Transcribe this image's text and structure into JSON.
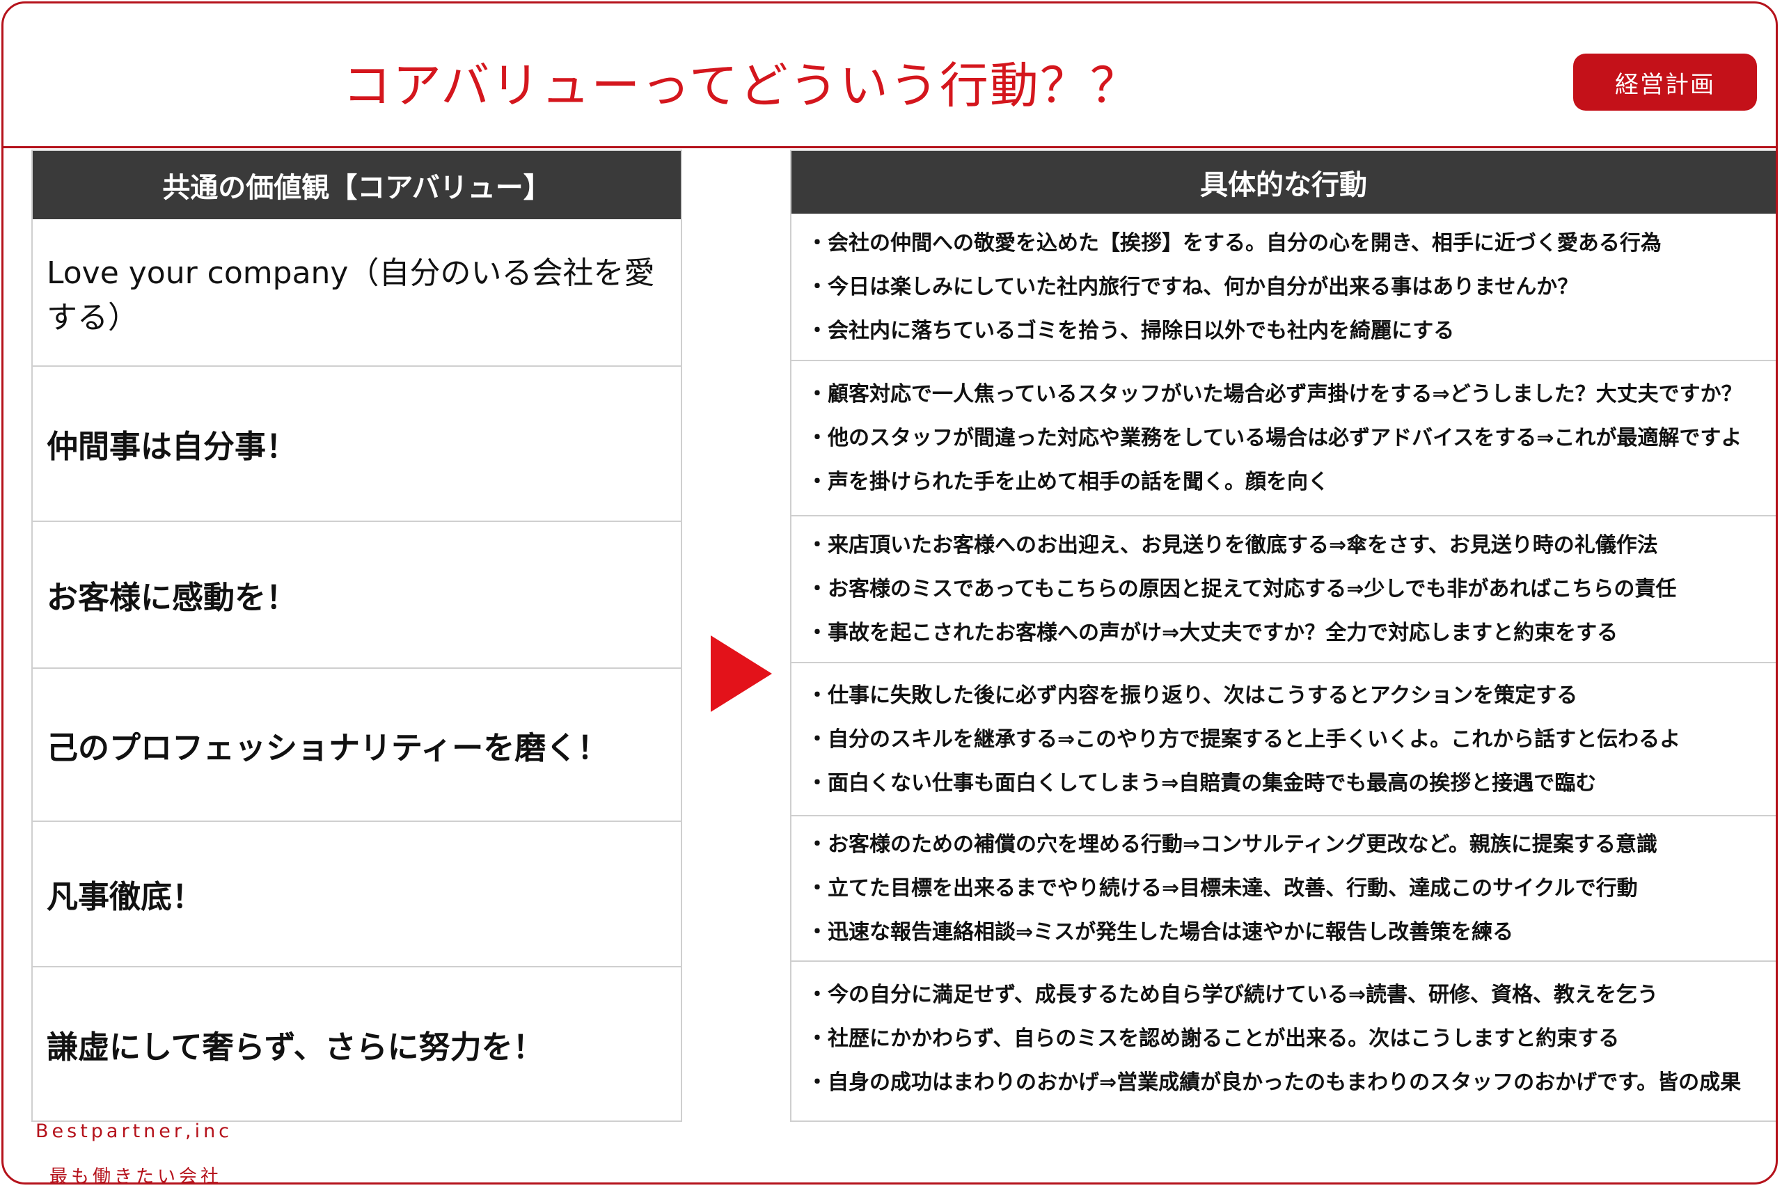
{
  "header": {
    "title": "コアバリューってどういう行動？？",
    "badge": "経営計画"
  },
  "left": {
    "heading": "共通の価値観【コアバリュー】",
    "values": [
      "Love your company（自分のいる会社を愛する）",
      "仲間事は自分事！",
      "お客様に感動を！",
      "己のプロフェッショナリティーを磨く！",
      "凡事徹底！",
      "謙虚にして奢らず、さらに努力を！"
    ]
  },
  "right": {
    "heading": "具体的な行動",
    "groups": [
      [
        "・会社の仲間への敬愛を込めた【挨拶】をする。自分の心を開き、相手に近づく愛ある行為",
        "・今日は楽しみにしていた社内旅行ですね、何か自分が出来る事はありませんか？",
        "・会社内に落ちているゴミを拾う、掃除日以外でも社内を綺麗にする"
      ],
      [
        "・顧客対応で一人焦っているスタッフがいた場合必ず声掛けをする⇒どうしました？大丈夫ですか？",
        "・他のスタッフが間違った対応や業務をしている場合は必ずアドバイスをする⇒これが最適解ですよ",
        "・声を掛けられた手を止めて相手の話を聞く。顔を向く"
      ],
      [
        "・来店頂いたお客様へのお出迎え、お見送りを徹底する⇒傘をさす、お見送り時の礼儀作法",
        "・お客様のミスであってもこちらの原因と捉えて対応する⇒少しでも非があればこちらの責任",
        "・事故を起こされたお客様への声がけ⇒大丈夫ですか？全力で対応しますと約束をする"
      ],
      [
        "・仕事に失敗した後に必ず内容を振り返り、次はこうするとアクションを策定する",
        "・自分のスキルを継承する⇒このやり方で提案すると上手くいくよ。これから話すと伝わるよ",
        "・面白くない仕事も面白くしてしまう⇒自賠責の集金時でも最高の挨拶と接遇で臨む"
      ],
      [
        "・お客様のための補償の穴を埋める行動⇒コンサルティング更改など。親族に提案する意識",
        "・立てた目標を出来るまでやり続ける⇒目標未達、改善、行動、達成このサイクルで行動",
        "・迅速な報告連絡相談⇒ミスが発生した場合は速やかに報告し改善策を練る"
      ],
      [
        "・今の自分に満足せず、成長するため自ら学び続けている⇒読書、研修、資格、教えを乞う",
        "・社歴にかかわらず、自らのミスを認め謝ることが出来る。次はこうしますと約束する",
        "・自身の成功はまわりのおかげ⇒営業成績が良かったのもまわりのスタッフのおかげです。皆の成果"
      ]
    ]
  },
  "footer": {
    "company": "Bestpartner,inc",
    "tagline": "最も働きたい会社"
  },
  "colors": {
    "accent": "#d4161d",
    "header_bg": "#3a3a3a",
    "badge_bg": "#c41119"
  }
}
